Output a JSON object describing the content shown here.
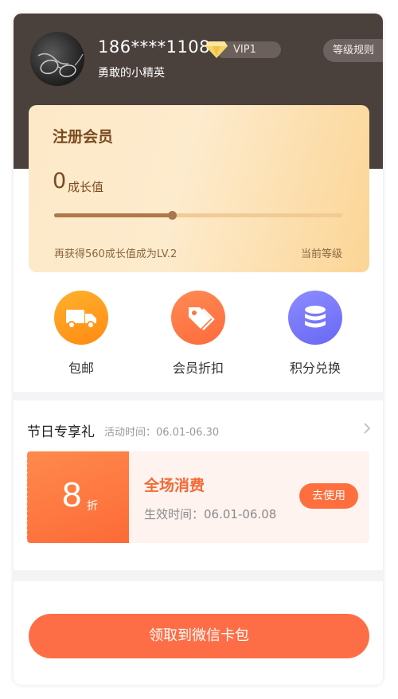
{
  "header": {
    "phone": "186****1108",
    "vip_badge": "VIP1",
    "nickname": "勇敢的小精英",
    "level_rules": "等级规则"
  },
  "member_card": {
    "title": "注册会员",
    "growth_value": "0",
    "growth_label": "成长值",
    "progress_percent": 41,
    "hint": "再获得560成长值成为LV.2",
    "current_level": "当前等级"
  },
  "benefits": [
    {
      "label": "包邮",
      "icon": "truck-icon",
      "color": "#ff9a1c"
    },
    {
      "label": "会员折扣",
      "icon": "price-tag-icon",
      "color": "#fd7744"
    },
    {
      "label": "积分兑换",
      "icon": "coin-stack-icon",
      "color": "#7575fb"
    }
  ],
  "gift": {
    "title": "节日专享礼",
    "period": "活动时间：06.01-06.30",
    "coupon": {
      "discount": "8",
      "unit": "折",
      "name": "全场消费",
      "valid": "生效时间：06.01-06.08",
      "use_button": "去使用"
    }
  },
  "footer": {
    "wechat_button": "领取到微信卡包"
  },
  "colors": {
    "header_bg": "#4a403c",
    "accent": "#fe6e46",
    "card_text": "#7a4a21"
  }
}
